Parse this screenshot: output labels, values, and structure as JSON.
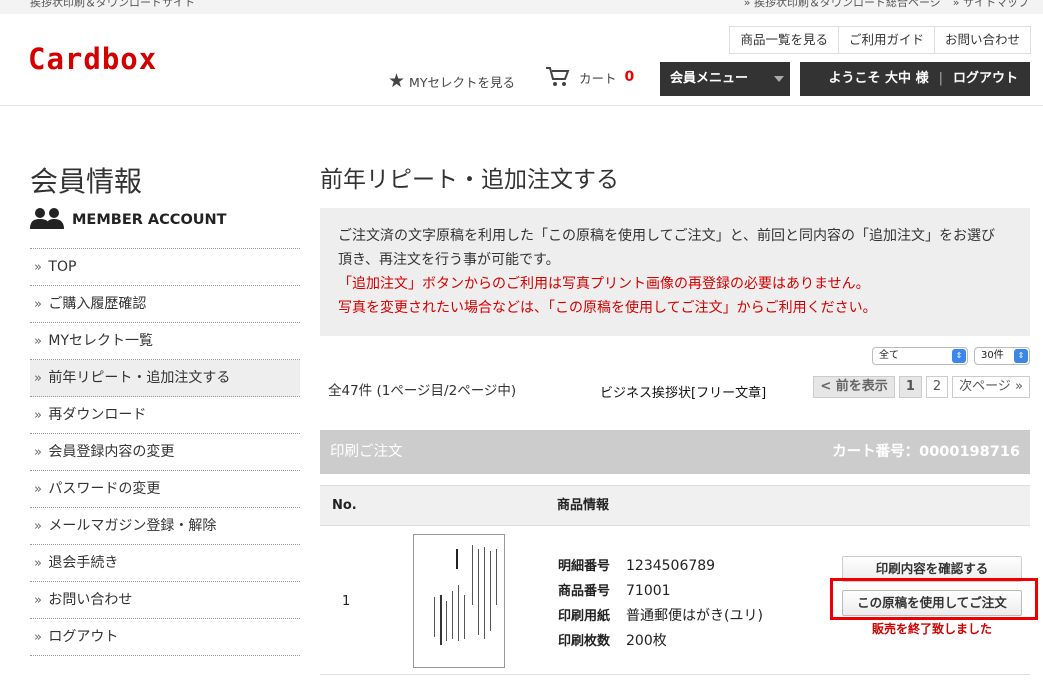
{
  "topstrip": {
    "left": "挨拶状印刷＆ダウンロードサイト",
    "right_links": [
      "» 挨拶状印刷＆ダウンロード総合ページ",
      "» サイトマップ"
    ]
  },
  "header": {
    "logo": "Cardbox",
    "nav": [
      "商品一覧を見る",
      "ご利用ガイド",
      "お問い合わせ"
    ],
    "myselect_label": "MYセレクトを見る",
    "cart_label": "カート",
    "cart_count": "0",
    "member_menu_label": "会員メニュー",
    "welcome_label": "ようこそ 大中 様",
    "logout_label": "ログアウト"
  },
  "sidebar": {
    "title": "会員情報",
    "subtitle": "MEMBER ACCOUNT",
    "items": [
      {
        "label": "TOP"
      },
      {
        "label": "ご購入履歴確認"
      },
      {
        "label": "MYセレクト一覧"
      },
      {
        "label": "前年リピート・追加注文する"
      },
      {
        "label": "再ダウンロード"
      },
      {
        "label": "会員登録内容の変更"
      },
      {
        "label": "パスワードの変更"
      },
      {
        "label": "メールマガジン登録・解除"
      },
      {
        "label": "退会手続き"
      },
      {
        "label": "お問い合わせ"
      },
      {
        "label": "ログアウト"
      }
    ]
  },
  "main": {
    "title": "前年リピート・追加注文する",
    "info_line1": "ご注文済の文字原稿を利用した「この原稿を使用してご注文」と、前回と同内容の「追加注文」をお選び頂き、再注文を行う事が可能です。",
    "info_red1": "「追加注文」ボタンからのご利用は写真プリント画像の再登録の必要はありません。",
    "info_red2": "写真を変更されたい場合などは、「この原稿を使用してご注文」からご利用ください。",
    "filter_select": "全て",
    "perpage_select": "30件",
    "count_text": "全47件 (1ページ目/2ページ中)",
    "product_name": "ビジネス挨拶状[フリー文章]",
    "pager": {
      "prev": "前を表示",
      "pages": [
        "1",
        "2"
      ],
      "next": "次ページ"
    },
    "order_bar_label": "印刷ご注文",
    "cart_number_label": "カート番号：0000198716",
    "table_headers": {
      "no": "No.",
      "info": "商品情報"
    },
    "row": {
      "no": "1",
      "details": [
        {
          "key": "明細番号",
          "value": "1234506789"
        },
        {
          "key": "商品番号",
          "value": "71001"
        },
        {
          "key": "印刷用紙",
          "value": "普通郵便はがき(ユリ)"
        },
        {
          "key": "印刷枚数",
          "value": "200枚"
        }
      ],
      "confirm_button": "印刷内容を確認する",
      "reuse_button": "この原稿を使用してご注文",
      "ended_text": "販売を終了致しました"
    }
  },
  "colors": {
    "brand_red": "#d40000",
    "dark": "#333333",
    "highlight": "#ee0000"
  }
}
